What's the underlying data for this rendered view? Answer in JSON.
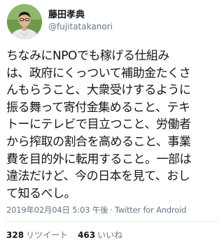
{
  "user": {
    "display_name": "藤田孝典",
    "handle": "@fujitatakanori"
  },
  "tweet": {
    "lines": [
      "ちなみにNPOでも稼げる仕組み",
      "は、政府にくっついて補助金たくさ",
      "んもらうこと、大衆受けするように",
      "振る舞って寄付金集めること、テキ",
      "トーにテレビで目立つこと、労働者",
      "から搾取の割合を高めること、事業",
      "費を目的外に転用すること。一部は",
      "違法だけど、今の日本を見て、おし",
      "て知るべし。"
    ],
    "timestamp": "2019年02月04日 5:03 午後",
    "separator": "·",
    "client": "Twitter for Android"
  },
  "stats": {
    "retweets_count": "328",
    "retweets_label": "リツイート",
    "likes_count": "463",
    "likes_label": "いいね"
  },
  "colors": {
    "text": "#14171a",
    "secondary": "#657786",
    "divider": "#e1e8ed",
    "avatar_bg": "#6f9a4a"
  },
  "icons": {
    "avatar": "profile-photo"
  }
}
